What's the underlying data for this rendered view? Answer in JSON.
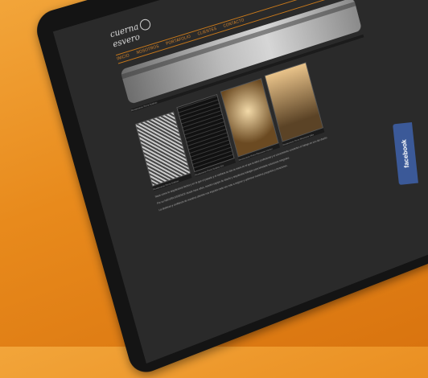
{
  "site": {
    "logo_line1": "cuerna",
    "logo_line2": "esvero",
    "nav": [
      "INICIO",
      "NOSOTROS",
      "PORTAFOLIO",
      "CLIENTES",
      "CONTACTO"
    ]
  },
  "gallery": [
    {
      "caption": "Restaurante Pizza Scalisto"
    },
    {
      "caption": "Restaurante Pizza Scalisto Ext"
    },
    {
      "caption": "Restaurante Pizza Ristorante Interior"
    },
    {
      "caption": "Restaurante Pizza Ristorante Sala"
    }
  ],
  "gallery_title": "Restaurante Pizza Scalisto",
  "paragraphs": [
    "Nace como tu arquitectura hecha y en la que el pasado y el mañana se dan la mano en el que la labor profesional y el conocimiento convierten el trabajo en uno del diseño.",
    "Por su NATURA ESSENCE desde hace años, nuestro equipo de diseño y arquitectos trabajan para brindarle soluciones integrales.",
    "La destreza y confianza de nuestros clientes nos impulsa cada vez más a mejorar y optimizar nuestros proyectos y creaciones."
  ],
  "facebook_label": "facebook"
}
